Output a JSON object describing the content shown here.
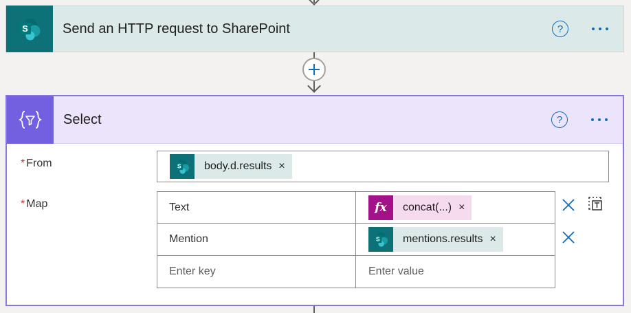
{
  "sharepoint_action": {
    "title": "Send an HTTP request to SharePoint",
    "help_label": "?"
  },
  "select_action": {
    "title": "Select",
    "help_label": "?",
    "from": {
      "label": "From",
      "required_mark": "*",
      "token": {
        "text": "body.d.results",
        "remove": "×",
        "icon": "sharepoint-icon"
      }
    },
    "map": {
      "label": "Map",
      "required_mark": "*",
      "rows": [
        {
          "key": "Text",
          "value_token": {
            "text": "concat(...)",
            "remove": "×",
            "icon": "fx-icon",
            "icon_text": "fx"
          }
        },
        {
          "key": "Mention",
          "value_token": {
            "text": "mentions.results",
            "remove": "×",
            "icon": "sharepoint-icon"
          }
        }
      ],
      "key_placeholder": "Enter key",
      "value_placeholder": "Enter value"
    }
  },
  "colors": {
    "sharepoint": "#0f7178",
    "sharepoint_header": "#dbe9e9",
    "select_icon": "#7360e1",
    "select_header": "#ebe4fb",
    "select_border": "#8b74e0",
    "expression": "#a4128a",
    "link_blue": "#0f6cbd"
  }
}
